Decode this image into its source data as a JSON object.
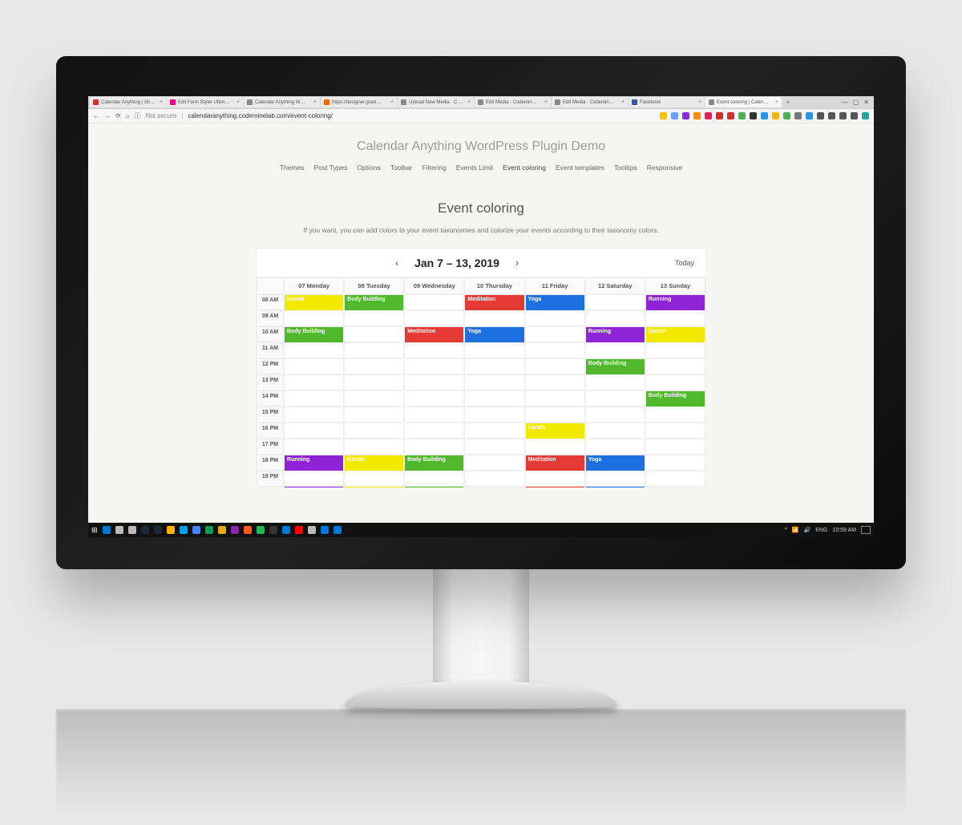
{
  "browser": {
    "tabs": [
      {
        "label": "Calendar Anything | Sh…",
        "fav": "#c33",
        "active": false
      },
      {
        "label": "Edit Form Styler Ultim…",
        "fav": "#e08",
        "active": false
      },
      {
        "label": "Calendar Anything W…",
        "fav": "#888",
        "active": false
      },
      {
        "label": "https://designer.gravi…",
        "fav": "#f60",
        "active": false
      },
      {
        "label": "Upload New Media · C…",
        "fav": "#888",
        "active": false
      },
      {
        "label": "Edit Media · Codemin…",
        "fav": "#888",
        "active": false
      },
      {
        "label": "Edit Media · Codemin…",
        "fav": "#888",
        "active": false
      },
      {
        "label": "Facebook",
        "fav": "#3b5998",
        "active": false
      },
      {
        "label": "Event coloring | Calen…",
        "fav": "#888",
        "active": true
      }
    ],
    "secure_label": "Not secure",
    "url": "calendaranything.codeminelab.com/event-coloring/",
    "ext_colors": [
      "#f5c400",
      "#66a3ff",
      "#8a2be2",
      "#ff8c00",
      "#e91e63",
      "#d32f2f",
      "#d32f2f",
      "#4caf50",
      "#333",
      "#2196f3",
      "#ffb300",
      "#4caf50",
      "#777",
      "#2196f3",
      "#555",
      "#555",
      "#555",
      "#555",
      "#26a69a"
    ]
  },
  "window": {
    "min": "—",
    "max": "▢",
    "close": "✕"
  },
  "site": {
    "title": "Calendar Anything WordPress Plugin Demo",
    "menu": [
      "Themes",
      "Post Types",
      "Options",
      "Toolbar",
      "Filtering",
      "Events Limit",
      "Event coloring",
      "Event templates",
      "Tooltips",
      "Responsive"
    ],
    "active_menu": 6,
    "section_title": "Event coloring",
    "section_desc": "If you want, you can add colors to your event taxonomies and colorize your events according to their taxonomy colors."
  },
  "calendar": {
    "range": "Jan 7 – 13, 2019",
    "today": "Today",
    "days": [
      "07 Monday",
      "08 Tuesday",
      "09 Wednesday",
      "10 Thursday",
      "11 Friday",
      "12 Saturday",
      "13 Sunday"
    ],
    "hours": [
      "08 AM",
      "09 AM",
      "10 AM",
      "11 AM",
      "12 PM",
      "13 PM",
      "14 PM",
      "15 PM",
      "16 PM",
      "17 PM",
      "18 PM",
      "19 PM"
    ],
    "colors": {
      "karate": "#f2e900",
      "body": "#4fb92b",
      "meditation": "#e53935",
      "yoga": "#1e6fe0",
      "running": "#8e24d6"
    },
    "events": [
      {
        "label": "Karate",
        "day": 0,
        "start": 0,
        "span": 2,
        "colorKey": "karate"
      },
      {
        "label": "Body Building",
        "day": 1,
        "start": 0,
        "span": 2,
        "colorKey": "body"
      },
      {
        "label": "Meditation",
        "day": 3,
        "start": 0,
        "span": 2,
        "colorKey": "meditation"
      },
      {
        "label": "Yoga",
        "day": 4,
        "start": 0,
        "span": 2,
        "colorKey": "yoga"
      },
      {
        "label": "Running",
        "day": 6,
        "start": 0,
        "span": 2,
        "colorKey": "running"
      },
      {
        "label": "Body Building",
        "day": 0,
        "start": 2,
        "span": 2,
        "colorKey": "body"
      },
      {
        "label": "Meditation",
        "day": 2,
        "start": 2,
        "span": 1,
        "colorKey": "meditation"
      },
      {
        "label": "Yoga",
        "day": 3,
        "start": 2,
        "span": 2,
        "colorKey": "yoga"
      },
      {
        "label": "Running",
        "day": 5,
        "start": 2,
        "span": 1,
        "colorKey": "running"
      },
      {
        "label": "Karate",
        "day": 6,
        "start": 2,
        "span": 2,
        "colorKey": "karate"
      },
      {
        "label": "Body Building",
        "day": 5,
        "start": 4,
        "span": 2,
        "colorKey": "body"
      },
      {
        "label": "Body Building",
        "day": 6,
        "start": 6,
        "span": 2,
        "colorKey": "body"
      },
      {
        "label": "Karate",
        "day": 4,
        "start": 8,
        "span": 2,
        "colorKey": "karate"
      },
      {
        "label": "Running",
        "day": 0,
        "start": 10,
        "span": 2,
        "colorKey": "running"
      },
      {
        "label": "Karate",
        "day": 1,
        "start": 10,
        "span": 2,
        "colorKey": "karate"
      },
      {
        "label": "Body Building",
        "day": 2,
        "start": 10,
        "span": 2,
        "colorKey": "body"
      },
      {
        "label": "Meditation",
        "day": 4,
        "start": 10,
        "span": 2,
        "colorKey": "meditation"
      },
      {
        "label": "Yoga",
        "day": 5,
        "start": 10,
        "span": 2,
        "colorKey": "yoga"
      }
    ]
  },
  "taskbar": {
    "icon_colors": [
      "#0078d7",
      "#bbb",
      "#bbb",
      "#1b2838",
      "#1b2838",
      "#ffb300",
      "#00a2ed",
      "#4285f4",
      "#0f9d58",
      "#e6a817",
      "#8e24aa",
      "#ff5722",
      "#1db954",
      "#333",
      "#0078d7",
      "#ff0000",
      "#bbb",
      "#0078d7",
      "#0078d7"
    ],
    "lang": "ENG",
    "time": "10:59 AM"
  }
}
